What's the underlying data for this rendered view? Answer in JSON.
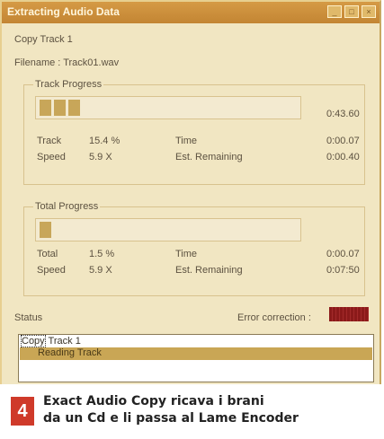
{
  "window": {
    "title": "Extracting Audio Data",
    "controls": [
      "minimize-icon",
      "maximize-icon",
      "close-icon"
    ]
  },
  "copy_track_label": "Copy Track  1",
  "filename_label": "Filename : Track01.wav",
  "track_progress": {
    "title": "Track Progress",
    "time_total": "0:43.60",
    "progress_fraction": 0.154,
    "rows": [
      {
        "l": "Track",
        "v": "15.4 %",
        "k": "Time",
        "t": "0:00.07"
      },
      {
        "l": "Speed",
        "v": "5.9 X",
        "k": "Est. Remaining",
        "t": "0:00.40"
      }
    ]
  },
  "total_progress": {
    "title": "Total Progress",
    "progress_fraction": 0.015,
    "rows": [
      {
        "l": "Total",
        "v": "1.5 %",
        "k": "Time",
        "t": "0:00.07"
      },
      {
        "l": "Speed",
        "v": "5.9 X",
        "k": "Est. Remaining",
        "t": "0:07:50"
      }
    ]
  },
  "status": {
    "label": "Status",
    "error_correction_label": "Error correction :",
    "error_indicator_color": "#8b1a1a"
  },
  "log": {
    "line1_selected": "Copy",
    "line1_rest": " Track  1",
    "line2": "Reading Track"
  },
  "caption": {
    "number": "4",
    "line1": "Exact Audio Copy ricava i brani",
    "line2": "da un Cd e li passa al Lame Encoder"
  }
}
